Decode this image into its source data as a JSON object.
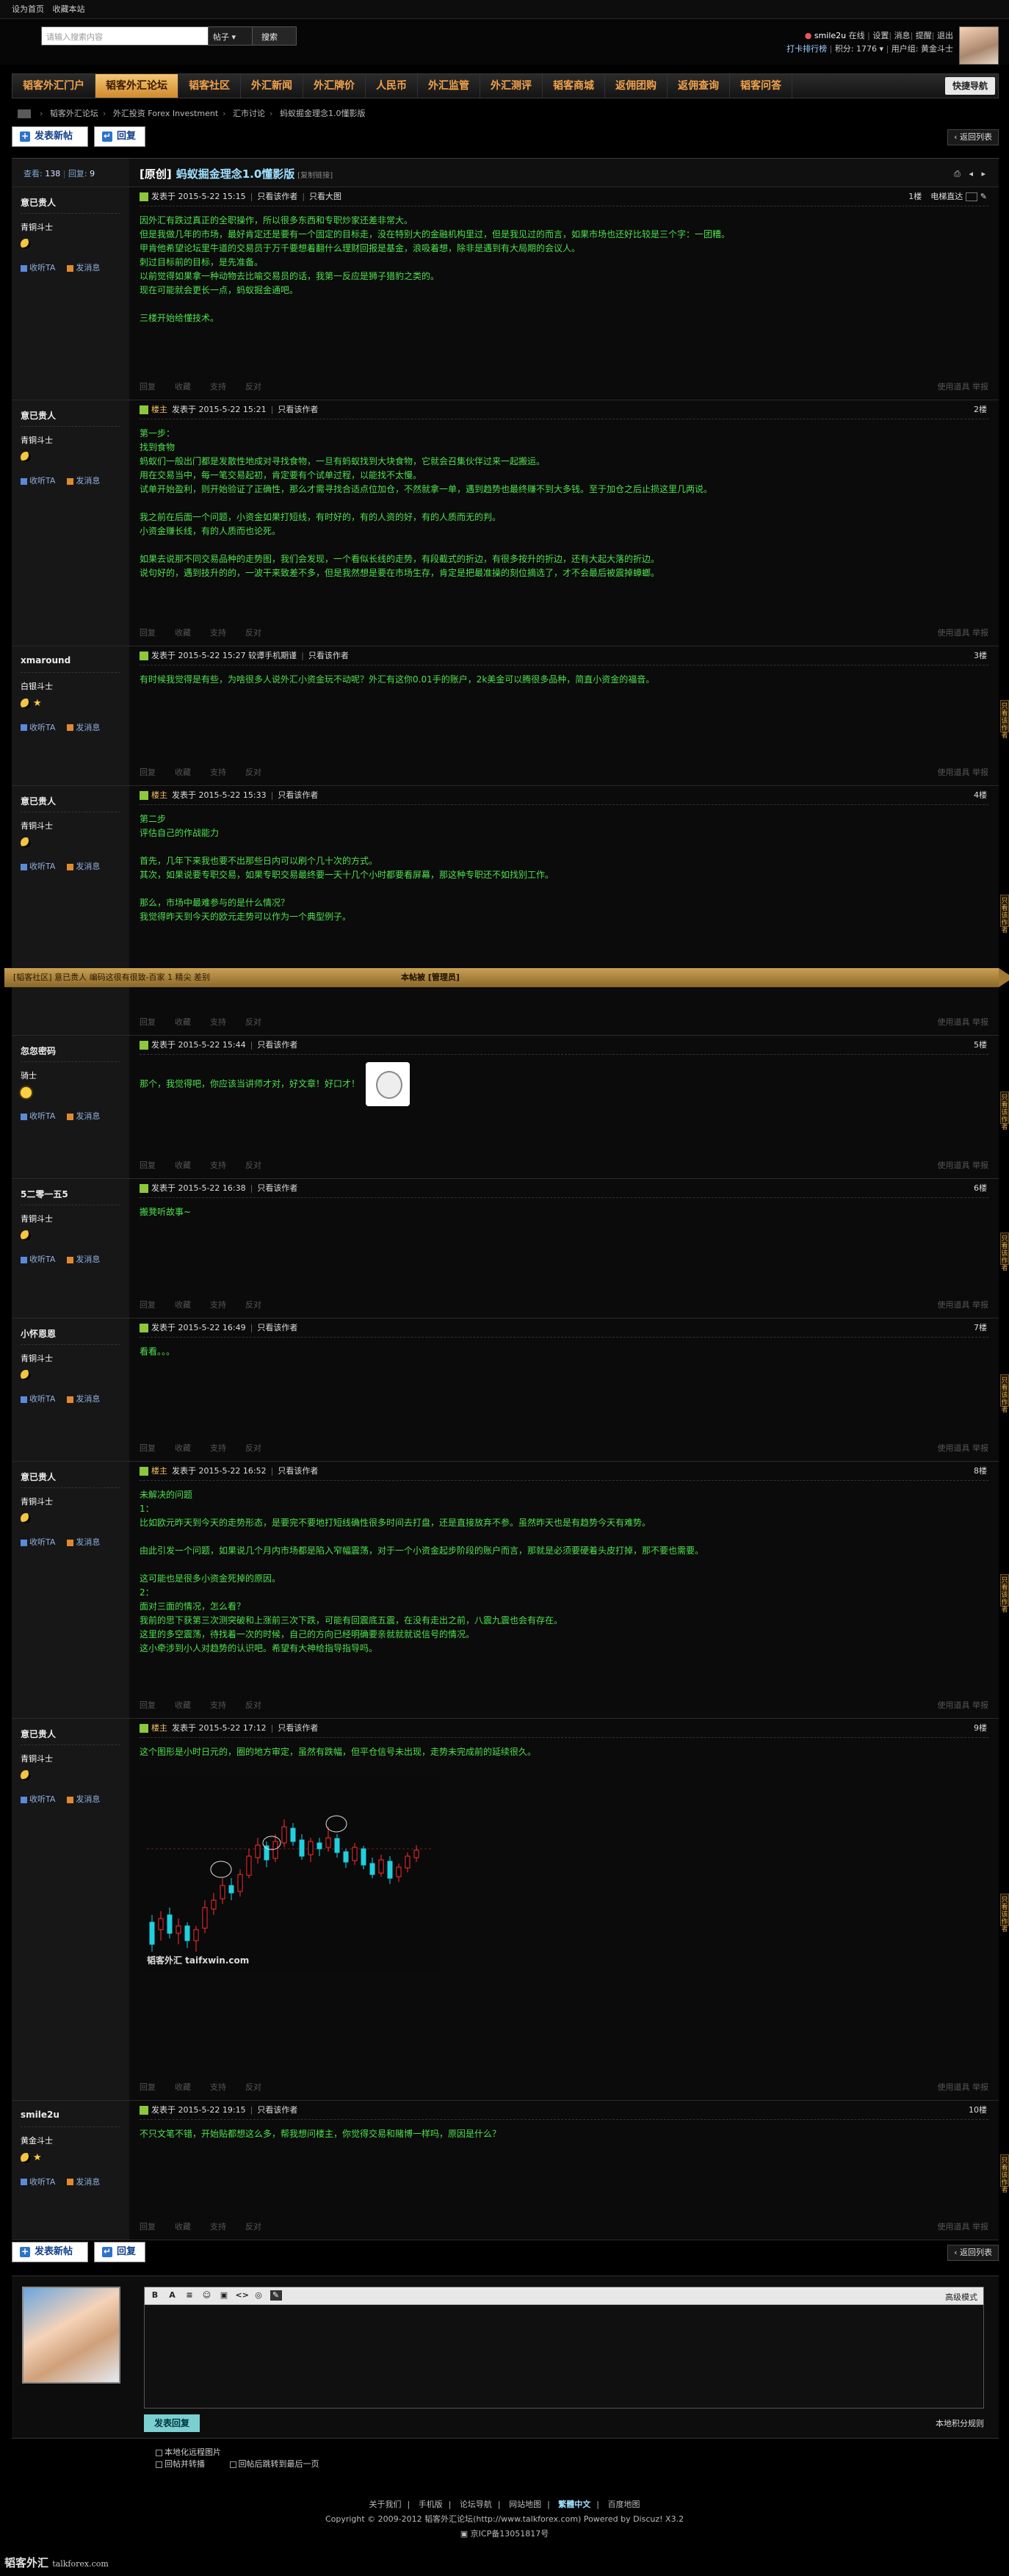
{
  "topbar": {
    "items": [
      "设为首页",
      "收藏本站"
    ]
  },
  "header": {
    "search_placeholder": "请输入搜索内容",
    "search_scope": "帖子",
    "search_button": "搜索",
    "user": {
      "name": "smile2u",
      "status": "在线",
      "links": [
        "设置",
        "消息",
        "提醒",
        "退出"
      ],
      "rank_link": "打卡排行榜",
      "points_label": "积分:",
      "points": "1776",
      "group_label": "用户组:",
      "group": "黄金斗士"
    }
  },
  "nav": {
    "items": [
      "韬客外汇门户",
      "韬客外汇论坛",
      "韬客社区",
      "外汇新闻",
      "外汇牌价",
      "人民币",
      "外汇监管",
      "外汇测评",
      "韬客商城",
      "返佣团购",
      "返佣查询",
      "韬客问答"
    ],
    "active_index": 1,
    "quick": "快捷导航"
  },
  "breadcrumb": [
    "韬客外汇论坛",
    "外汇投资 Forex Investment",
    "汇市讨论",
    "蚂蚁掘金理念1.0懂影版"
  ],
  "actions": {
    "new_post": "发表新帖",
    "reply": "回复",
    "back": "返回列表"
  },
  "thread": {
    "views_label": "查看:",
    "views": "138",
    "replies_label": "回复:",
    "replies": "9",
    "prefix": "[原创]",
    "title": "蚂蚁掘金理念1.0懂影版",
    "copy_link": "[复制链接]",
    "post_icons": "⎙ ◂ ▸"
  },
  "common": {
    "published": "发表于",
    "view_author": "只看该作者",
    "landlord": "楼主",
    "view_large": "只看大图",
    "send_message": "发消息",
    "add_friend": "收听TA",
    "foot": [
      "回复",
      "支持",
      "反对",
      "收藏",
      "支持",
      "反对",
      "举报"
    ],
    "foot_short": [
      "回复",
      "收藏",
      "支持",
      "反对"
    ],
    "report": "使用道具",
    "report2": "举报",
    "side_tab": "只看该作者",
    "electric_direct": "电梯直达"
  },
  "posts": [
    {
      "author": "意已贵人",
      "rank": "青铜斗士",
      "icons": "moon",
      "time": "2015-5-22 15:15",
      "floor": "1楼",
      "is_op": false,
      "extra": [
        "只看大图"
      ],
      "lines": [
        "因外汇有跌过真正的全职操作，所以很多东西和专职炒家还差非常大。",
        "但是我做几年的市场，最好肯定还是要有一个固定的目标走，没在特别大的金融机构里过，但是我见过的而言，如果市场也还好比较是三个字：一团糟。",
        "甲肯他希望论坛里牛道的交易员于万千要想着翻什么理财回报是基金，浪吸着想，除非是遇到有大局期的会议人。",
        "刺过目标前的目标，是先准备。",
        "以前觉得如果拿一种动物去比喻交易员的话，我第一反应是狮子猎豹之类的。",
        "现在可能就会更长一点，蚂蚁掘金通吧。",
        "",
        "三楼开始给懂技术。"
      ]
    },
    {
      "author": "意已贵人",
      "rank": "青铜斗士",
      "icons": "moon",
      "time": "2015-5-22 15:21",
      "floor": "2楼",
      "is_op": true,
      "extra": [],
      "lines": [
        "第一步：",
        "找到食物",
        "蚂蚁们一般出门都是发散性地成对寻找食物，一旦有蚂蚁找到大块食物，它就会召集伙伴过来一起搬运。",
        "用在交易当中，每一笔交易起初，肯定要有个试单过程，以能找不太慢。",
        "试单开始盈利，则开始验证了正确性，那么才需寻找合适点位加仓，不然就拿一单，遇到趋势也最终赚不到大多钱。至于加仓之后止损这里几两说。",
        "",
        "我之前在后面一个问题，小资金如果打短线，有时好的，有的人资的好，有的人质而无的判。",
        "小资金赚长线，有的人质而也论死。",
        "",
        "如果去说那不同交易品种的走势图，我们会发现，一个看似长线的走势，有段截式的折边，有很多按升的折边，还有大起大落的折边。",
        "说句好的，遇到技升的的，一波干来致差不多，但是我然想是要在市场生存，肯定是把最准操的刻位摘选了，才不会最后被震掉蟑螂。"
      ]
    },
    {
      "author": "xmaround",
      "rank": "白银斗士",
      "icons": "moonstar",
      "time": "2015-5-22 15:27 较谭手机期谨",
      "floor": "3楼",
      "is_op": false,
      "extra": [],
      "lines": [
        "有时候我觉得是有些，为啥很多人说外汇小资金玩不动呢？外汇有这你0.01手的账户，2k美金可以腾很多品种，简直小资金的福音。"
      ]
    },
    {
      "author": "意已贵人",
      "rank": "青铜斗士",
      "icons": "moon",
      "time": "2015-5-22 15:33",
      "floor": "4楼",
      "is_op": true,
      "extra": [],
      "lines": [
        "第二步",
        "评估自己的作战能力",
        "",
        "首先，几年下来我也要不出那些日内可以刷个几十次的方式。",
        "其次，如果说要专职交易，如果专职交易最终要一天十几个小时都要看屏幕，那这种专职还不如找别工作。",
        "",
        "那么，市场中最难参与的是什么情况？",
        "我觉得昨天到今天的欧元走势可以作为一个典型例子。"
      ],
      "sign": {
        "left": "[韬客社区] 意已贵人 编码这很有很致-百家 1 精尖 差别",
        "mid": "本帖被 [管理员]",
        "right": ""
      }
    },
    {
      "author": "忽忽密码",
      "rank": "骑士",
      "icons": "sun",
      "time": "2015-5-22 15:44",
      "floor": "5楼",
      "is_op": false,
      "extra": [],
      "lines": [
        "那个，我觉得吧，你应该当讲师才对，好文章！好口才！"
      ]
    },
    {
      "author": "5二零一五5",
      "rank": "青铜斗士",
      "icons": "moon",
      "time": "2015-5-22 16:38",
      "floor": "6楼",
      "is_op": false,
      "extra": [],
      "lines": [
        "搬凳听故事~"
      ]
    },
    {
      "author": "小怀恩恩",
      "rank": "青铜斗士",
      "icons": "moon",
      "time": "2015-5-22 16:49",
      "floor": "7楼",
      "is_op": false,
      "extra": [],
      "lines": [
        "看看。。。"
      ]
    },
    {
      "author": "意已贵人",
      "rank": "青铜斗士",
      "icons": "moon",
      "time": "2015-5-22 16:52",
      "floor": "8楼",
      "is_op": true,
      "extra": [],
      "lines": [
        "未解决的问题",
        "1：",
        "比如欧元昨天到今天的走势形态，是要完不要地打短线确性很多时间去打盘，还是直接放弃不参。虽然昨天也是有趋势今天有难势。",
        "",
        "由此引发一个问题，如果说几个月内市场都是陷入窄幅震荡，对于一个小资金起步阶段的账户而言，那就是必须要硬着头皮打掉，那不要也需要。",
        "",
        "这可能也是很多小资金死掉的原因。",
        "2：",
        "面对三面的情况，怎么看？",
        "我前的思下获第三次测突破和上涨前三次下跌，可能有回震底五震，在没有走出之前，八震九震也会有存在。",
        "这里的多空震荡，待找着一次的时候，自己的方向已经明确要亲就就就说信号的情况。",
        "这小牵涉到小人对趋势的认识吧。希望有大神给指导指导吗。"
      ]
    },
    {
      "author": "意已贵人",
      "rank": "青铜斗士",
      "icons": "moon",
      "time": "2015-5-22 17:12",
      "floor": "9楼",
      "is_op": true,
      "extra": [],
      "lines": [
        "这个图形是小时日元的，圈的地方审定，虽然有跌幅，但平仓信号未出现，走势未完成前的延续很久。"
      ],
      "chart": true
    },
    {
      "author": "smile2u",
      "rank": "黄金斗士",
      "icons": "moonstar",
      "time": "2015-5-22 19:15",
      "floor": "10楼",
      "is_op": false,
      "extra": [],
      "lines": [
        "不只文笔不错，开始贴都想这么多，帮我想问楼主，你觉得交易和赌博一样吗，原因是什么？"
      ]
    }
  ],
  "chart_watermark": "韬客外汇 taifxwin.com",
  "reply": {
    "toolbar": [
      "B",
      "A",
      "≡",
      "☺",
      "▣",
      "<>",
      "◎",
      "✎"
    ],
    "advanced": "高级模式",
    "submit": "发表回复",
    "local_space": "本地积分规则",
    "options": [
      "本地化远程图片",
      "回帖并转播",
      "回帖后跳转到最后一页"
    ]
  },
  "footer": {
    "links": [
      "关于我们",
      "手机版",
      "论坛导航",
      "网站地图",
      "繁體中文",
      "百度地图"
    ],
    "copyright": "Copyright © 2009-2012 韬客外汇论坛(http://www.talkforex.com) Powered by Discuz! X3.2",
    "icp": "京ICP备13051817号"
  },
  "watermark": {
    "name": "韬客外汇",
    "url": "talkforex.com"
  },
  "colors": {
    "accent": "#f2a24a",
    "text_green": "#4ee04e",
    "link_blue": "#9fe0ff"
  }
}
